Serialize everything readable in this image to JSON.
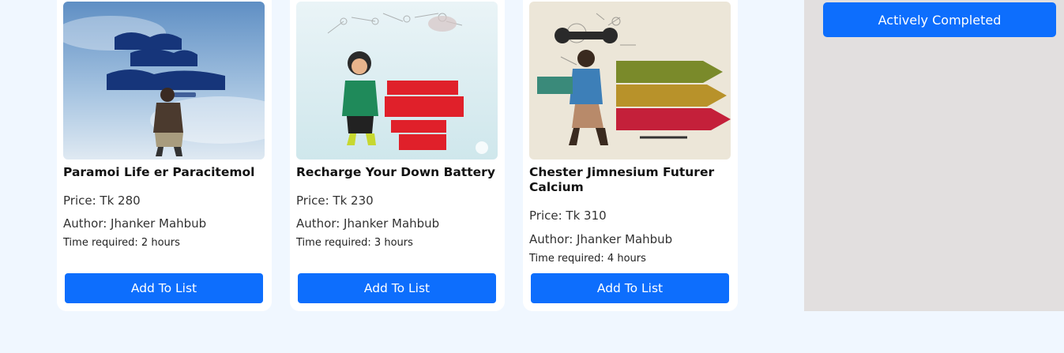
{
  "books": [
    {
      "title": "Paramoi Life er Paracitemol",
      "price": "Price: Tk 280",
      "author": "Author: Jhanker Mahbub",
      "time": "Time required: 2 hours",
      "button": "Add To List"
    },
    {
      "title": "Recharge Your Down Battery",
      "price": "Price: Tk 230",
      "author": "Author: Jhanker Mahbub",
      "time": "Time required: 3 hours",
      "button": "Add To List"
    },
    {
      "title": "Chester Jimnesium Futurer Calcium",
      "price": "Price: Tk 310",
      "author": "Author: Jhanker Mahbub",
      "time": "Time required: 4 hours",
      "button": "Add To List"
    }
  ],
  "sidebar": {
    "status_button": "Actively Completed"
  },
  "colors": {
    "primary": "#0d6efd",
    "page_background": "#f0f7ff",
    "sidebar_background": "#e2dfdf"
  }
}
